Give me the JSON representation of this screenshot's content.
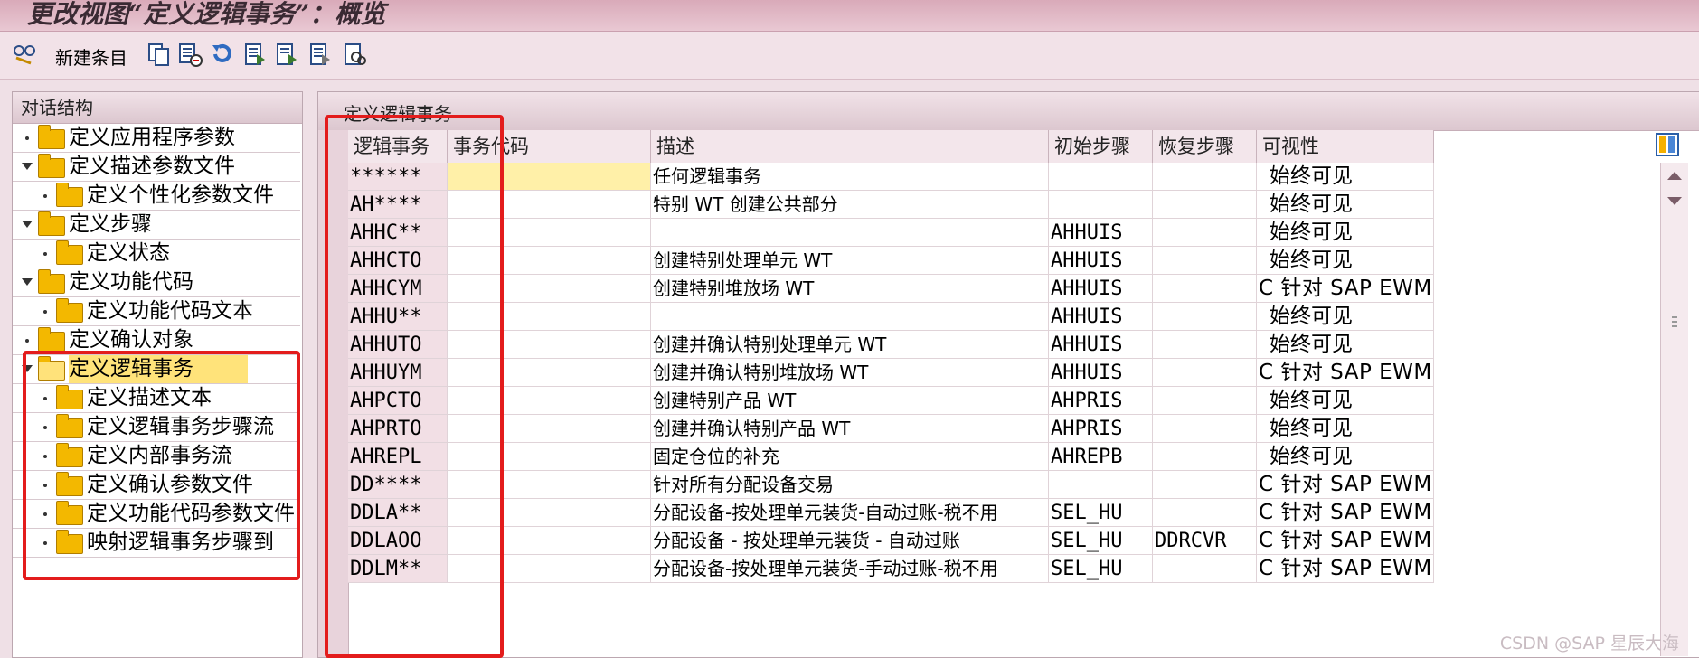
{
  "window": {
    "title": "更改视图“定义逻辑事务”：概览"
  },
  "toolbar": {
    "new_entries_label": "新建条目",
    "icons": [
      "glasses-icon",
      "copy-icon",
      "delete-icon",
      "undo-icon",
      "select-all-icon",
      "select-block-icon",
      "deselect-icon",
      "details-icon"
    ]
  },
  "dialog_structure": {
    "header": "对话结构",
    "items": [
      {
        "label": "定义应用程序参数",
        "level": 0,
        "expanded": false,
        "selected": false
      },
      {
        "label": "定义描述参数文件",
        "level": 0,
        "expanded": true,
        "selected": false
      },
      {
        "label": "定义个性化参数文件",
        "level": 1,
        "expanded": false,
        "selected": false
      },
      {
        "label": "定义步骤",
        "level": 0,
        "expanded": true,
        "selected": false
      },
      {
        "label": "定义状态",
        "level": 1,
        "expanded": false,
        "selected": false
      },
      {
        "label": "定义功能代码",
        "level": 0,
        "expanded": true,
        "selected": false
      },
      {
        "label": "定义功能代码文本",
        "level": 1,
        "expanded": false,
        "selected": false
      },
      {
        "label": "定义确认对象",
        "level": 0,
        "expanded": false,
        "selected": false
      },
      {
        "label": "定义逻辑事务",
        "level": 0,
        "expanded": true,
        "selected": true
      },
      {
        "label": "定义描述文本",
        "level": 1,
        "expanded": false,
        "selected": false
      },
      {
        "label": "定义逻辑事务步骤流",
        "level": 1,
        "expanded": false,
        "selected": false
      },
      {
        "label": "定义内部事务流",
        "level": 1,
        "expanded": false,
        "selected": false
      },
      {
        "label": "定义确认参数文件",
        "level": 1,
        "expanded": false,
        "selected": false
      },
      {
        "label": "定义功能代码参数文件",
        "level": 1,
        "expanded": false,
        "selected": false
      },
      {
        "label": "映射逻辑事务步骤到",
        "level": 1,
        "expanded": false,
        "selected": false
      }
    ]
  },
  "table": {
    "title": "定义逻辑事务",
    "columns": [
      "逻辑事务",
      "事务代码",
      "描述",
      "初始步骤",
      "恢复步骤",
      "可视性"
    ],
    "rows": [
      {
        "key": "******",
        "tcode": "",
        "desc": "任何逻辑事务",
        "init": "",
        "recover": "",
        "vis": "始终可见"
      },
      {
        "key": "AH****",
        "tcode": "",
        "desc": "特别 WT 创建公共部分",
        "init": "",
        "recover": "",
        "vis": "始终可见"
      },
      {
        "key": "AHHC**",
        "tcode": "",
        "desc": "",
        "init": "AHHUIS",
        "recover": "",
        "vis": "始终可见"
      },
      {
        "key": "AHHCTO",
        "tcode": "",
        "desc": "创建特别处理单元 WT",
        "init": "AHHUIS",
        "recover": "",
        "vis": "始终可见"
      },
      {
        "key": "AHHCYM",
        "tcode": "",
        "desc": "创建特别堆放场 WT",
        "init": "AHHUIS",
        "recover": "",
        "vis": "C 针对 SAP EWM 和"
      },
      {
        "key": "AHHU**",
        "tcode": "",
        "desc": "",
        "init": "AHHUIS",
        "recover": "",
        "vis": "始终可见"
      },
      {
        "key": "AHHUTO",
        "tcode": "",
        "desc": "创建并确认特别处理单元 WT",
        "init": "AHHUIS",
        "recover": "",
        "vis": "始终可见"
      },
      {
        "key": "AHHUYM",
        "tcode": "",
        "desc": "创建并确认特别堆放场 WT",
        "init": "AHHUIS",
        "recover": "",
        "vis": "C 针对 SAP EWM 和"
      },
      {
        "key": "AHPCTO",
        "tcode": "",
        "desc": "创建特别产品 WT",
        "init": "AHPRIS",
        "recover": "",
        "vis": "始终可见"
      },
      {
        "key": "AHPRTO",
        "tcode": "",
        "desc": "创建并确认特别产品 WT",
        "init": "AHPRIS",
        "recover": "",
        "vis": "始终可见"
      },
      {
        "key": "AHREPL",
        "tcode": "",
        "desc": "固定仓位的补充",
        "init": "AHREPB",
        "recover": "",
        "vis": "始终可见"
      },
      {
        "key": "DD****",
        "tcode": "",
        "desc": "针对所有分配设备交易",
        "init": "",
        "recover": "",
        "vis": "C 针对 SAP EWM 和"
      },
      {
        "key": "DDLA**",
        "tcode": "",
        "desc": "分配设备-按处理单元装货-自动过账-税不用",
        "init": "SEL_HU",
        "recover": "",
        "vis": "C 针对 SAP EWM 和"
      },
      {
        "key": "DDLAOO",
        "tcode": "",
        "desc": "分配设备 - 按处理单元装货 - 自动过账",
        "init": "SEL_HU",
        "recover": "DDRCVR",
        "vis": "C 针对 SAP EWM 和"
      },
      {
        "key": "DDLM**",
        "tcode": "",
        "desc": "分配设备-按处理单元装货-手动过账-税不用",
        "init": "SEL_HU",
        "recover": "",
        "vis": "C 针对 SAP EWM 和"
      }
    ]
  },
  "watermark": "CSDN @SAP 星辰大海",
  "colors": {
    "titlebar": "#d9aab9",
    "highlight_box": "#e31c1c",
    "selected_node": "#ffe37a",
    "active_cell": "#fff0a8"
  }
}
